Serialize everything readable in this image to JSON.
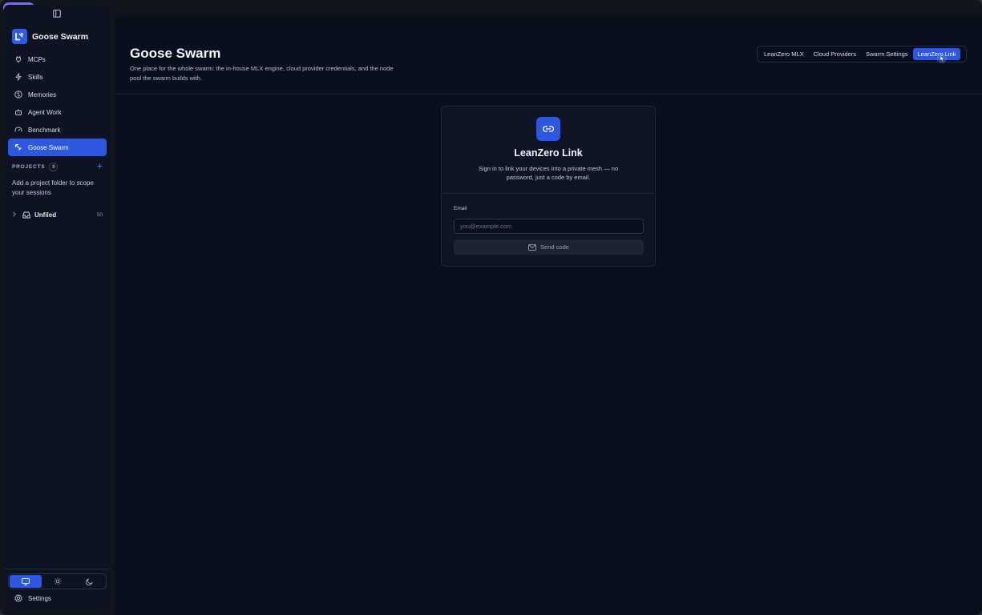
{
  "app": {
    "name": "Goose Swarm"
  },
  "sidebar": {
    "items": [
      {
        "label": "MCPs",
        "icon": "plug-icon"
      },
      {
        "label": "Skills",
        "icon": "bolt-icon"
      },
      {
        "label": "Memories",
        "icon": "brain-icon"
      },
      {
        "label": "Agent Work",
        "icon": "robot-icon"
      },
      {
        "label": "Benchmark",
        "icon": "gauge-icon"
      },
      {
        "label": "Goose Swarm",
        "icon": "swarm-icon",
        "active": true
      }
    ],
    "projects": {
      "label": "PROJECTS",
      "count": "0",
      "hint": "Add a project folder to scope your sessions"
    },
    "unfiled": {
      "label": "Unfiled",
      "count": "50"
    },
    "theme": {
      "options": [
        "system",
        "light",
        "dark"
      ],
      "selected": "system"
    },
    "settings_label": "Settings"
  },
  "header": {
    "title": "Goose Swarm",
    "description": "One place for the whole swarm: the in-house MLX engine, cloud provider credentials, and the node pool the swarm builds with.",
    "tabs": [
      {
        "label": "LeanZero MLX"
      },
      {
        "label": "Cloud Providers"
      },
      {
        "label": "Swarm Settings"
      },
      {
        "label": "LeanZero Link",
        "active": true
      }
    ]
  },
  "card": {
    "title": "LeanZero Link",
    "description": "Sign in to link your devices into a private mesh — no password, just a code by email.",
    "email_label": "Email",
    "email_placeholder": "you@example.com",
    "email_value": "",
    "send_label": "Send code"
  },
  "colors": {
    "accent": "#2d57e0",
    "background": "#0a0f1d",
    "sidebar": "#0d1320"
  }
}
